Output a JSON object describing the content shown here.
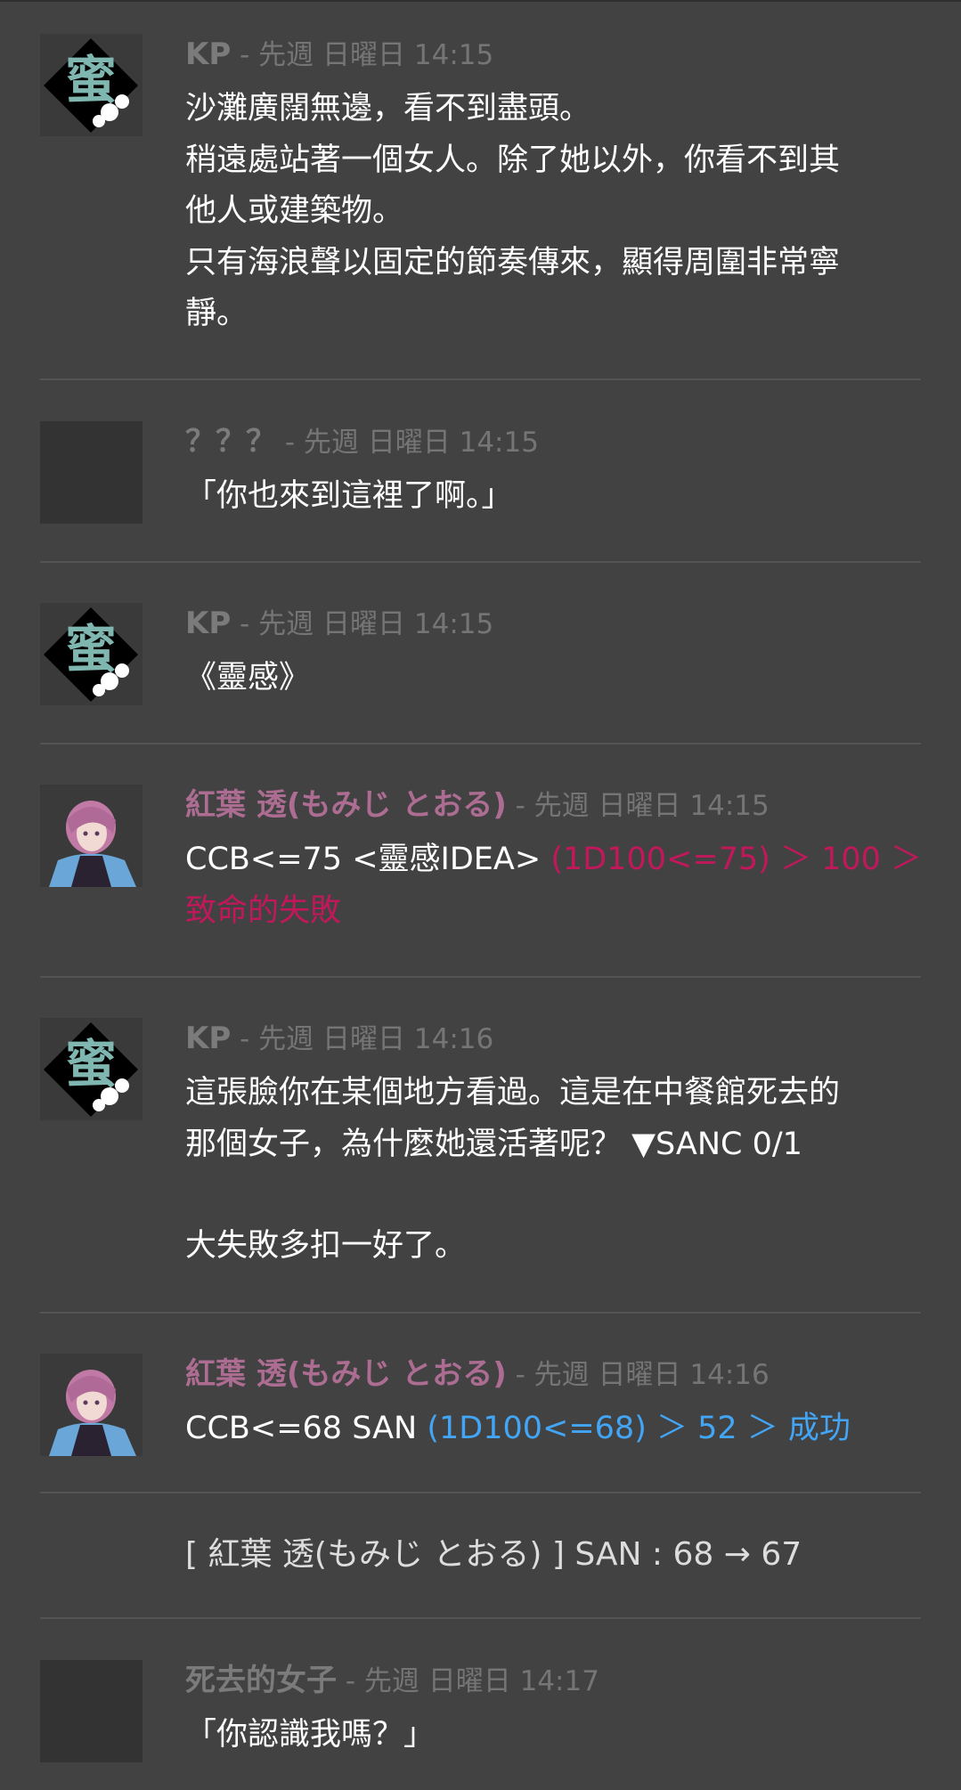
{
  "messages": [
    {
      "name": "KP",
      "meta": " - 先週 日曜日 14:15",
      "lines": [
        "沙灘廣闊無邊，看不到盡頭。",
        "稍遠處站著一個女人。除了她以外，你看不到其",
        "他人或建築物。",
        "只有海浪聲以固定的節奏傳來，顯得周圍非常寧",
        "靜。"
      ]
    },
    {
      "name": "？？？",
      "meta": " - 先週 日曜日 14:15",
      "lines": [
        "「你也來到這裡了啊。」"
      ]
    },
    {
      "name": "KP",
      "meta": " - 先週 日曜日 14:15",
      "lines": [
        "《靈感》"
      ]
    },
    {
      "name": "紅葉 透(もみじ とおる)",
      "meta": " - 先週 日曜日 14:15",
      "line1_plain": "CCB<=75 <靈感IDEA> ",
      "line1_red": "(1D100<=75) ＞ 100 ＞",
      "line2_red": "致命的失敗"
    },
    {
      "name": "KP",
      "meta": " - 先週 日曜日 14:16",
      "lines": [
        "這張臉你在某個地方看過。這是在中餐館死去的",
        "那個女子，為什麼她還活著呢？ ▼SANC 0/1",
        "",
        "大失敗多扣一好了。"
      ]
    },
    {
      "name": "紅葉 透(もみじ とおる)",
      "meta": " - 先週 日曜日 14:16",
      "line1_plain": "CCB<=68 SAN ",
      "line1_blue": "(1D100<=68) ＞ 52 ＞ 成功"
    },
    {
      "system": "[ 紅葉 透(もみじ とおる) ] SAN : 68 → 67"
    },
    {
      "name": "死去的女子",
      "meta": " - 先週 日曜日 14:17",
      "lines": [
        "「你認識我嗎？」"
      ]
    }
  ],
  "colors": {
    "background": "#424242",
    "name_default": "#7b7b7b",
    "name_pink": "#ad6d92",
    "fail_red": "#c2185b",
    "success_blue": "#42a5f5"
  },
  "icons": {
    "kp_avatar": "calligraphy-flower-avatar",
    "player_avatar": "pink-haired-character-avatar",
    "empty_avatar": "blank-avatar"
  }
}
